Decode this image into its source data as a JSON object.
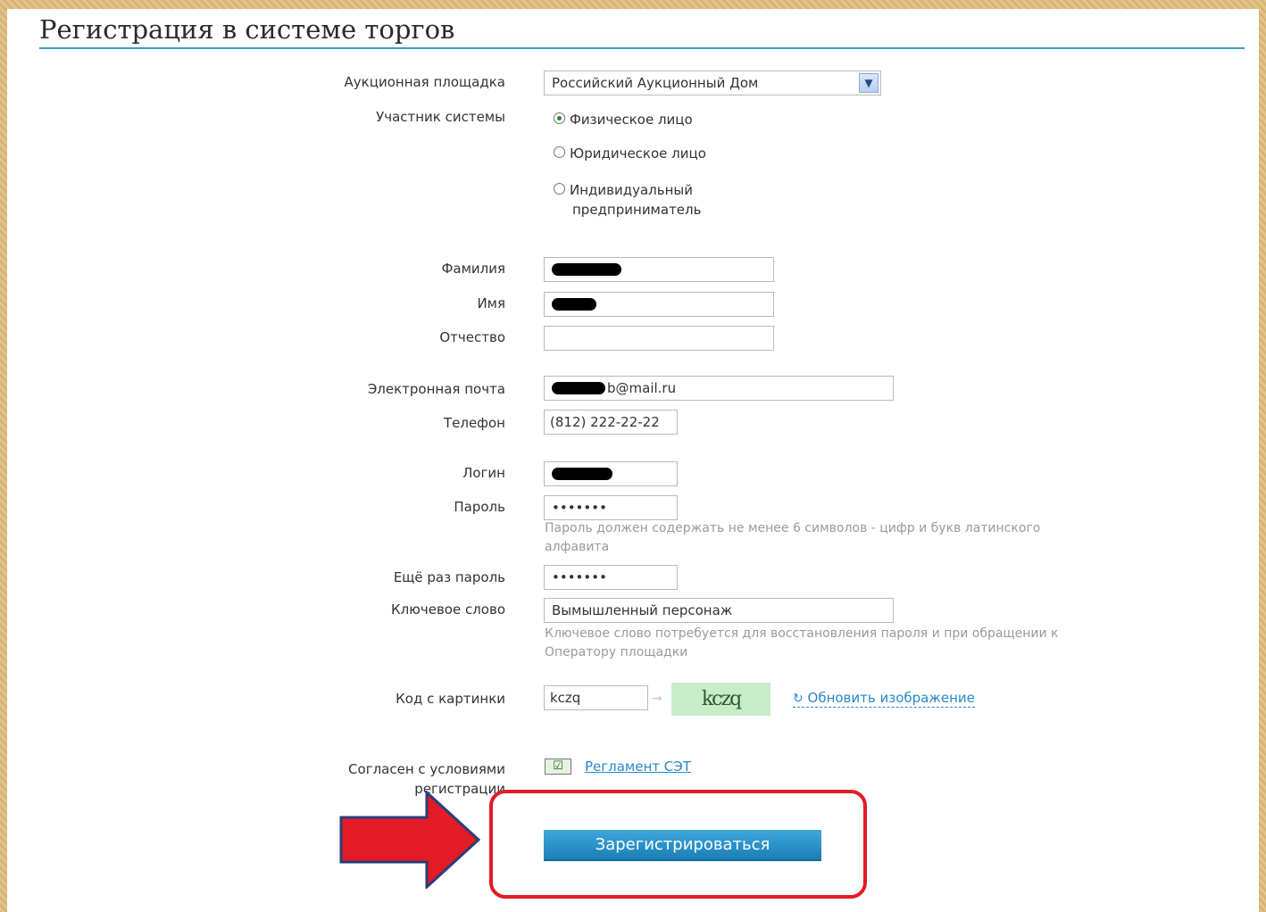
{
  "page": {
    "title": "Регистрация в системе торгов"
  },
  "form": {
    "platform": {
      "label": "Аукционная площадка",
      "value": "Российский Аукционный Дом"
    },
    "participant": {
      "label": "Участник системы",
      "options": [
        {
          "label": "Физическое лицо",
          "selected": true
        },
        {
          "label": "Юридическое лицо",
          "selected": false
        },
        {
          "label_line1": "Индивидуальный",
          "label_line2": "предприниматель",
          "selected": false
        }
      ]
    },
    "surname": {
      "label": "Фамилия",
      "value": ""
    },
    "name": {
      "label": "Имя",
      "value": ""
    },
    "patronymic": {
      "label": "Отчество",
      "value": ""
    },
    "email": {
      "label": "Электронная почта",
      "value_suffix": "b@mail.ru"
    },
    "phone": {
      "label": "Телефон",
      "value": "(812) 222-22-22"
    },
    "login": {
      "label": "Логин",
      "value": ""
    },
    "password": {
      "label": "Пароль",
      "value": "•••••••",
      "hint_line1": "Пароль должен содержать не менее 6 символов - цифр и букв латинского",
      "hint_line2": "алфавита"
    },
    "password_repeat": {
      "label": "Ещё раз пароль",
      "value": "•••••••"
    },
    "keyword": {
      "label": "Ключевое слово",
      "value": "Вымышленный персонаж",
      "hint_line1": "Ключевое слово потребуется для восстановления пароля и при обращении к",
      "hint_line2": "Оператору площадки"
    },
    "captcha": {
      "label": "Код с картинки",
      "value": "kczq",
      "image_text": "kczq",
      "refresh_label": "Обновить изображение"
    },
    "agree": {
      "label": "Согласен с условиями регистрации",
      "link_label": "Регламент СЭТ",
      "checked": true
    },
    "submit_label": "Зарегистрироваться"
  },
  "annotations": {
    "highlight_color": "#e21b24",
    "arrow_color": "#e21b24"
  }
}
